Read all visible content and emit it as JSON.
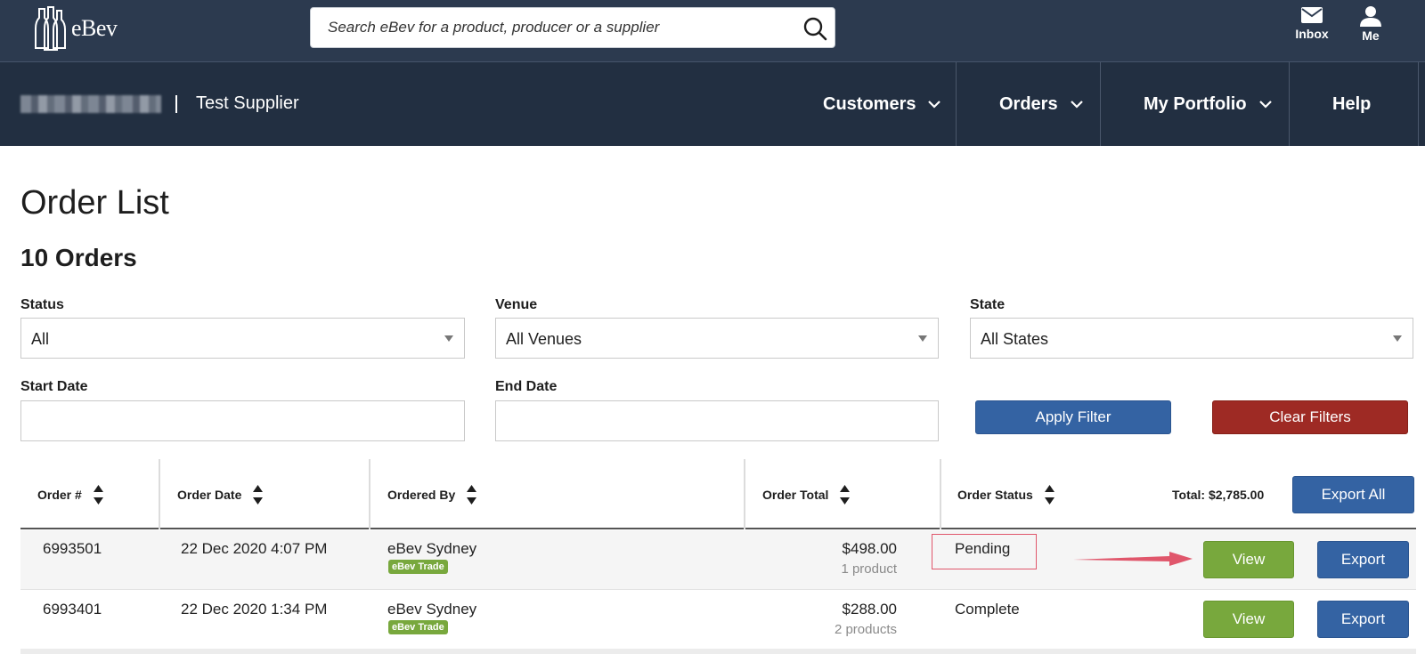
{
  "brand": {
    "name": "eBev"
  },
  "search": {
    "placeholder": "Search eBev for a product, producer or a supplier"
  },
  "top_actions": {
    "inbox_label": "Inbox",
    "me_label": "Me"
  },
  "subnav": {
    "supplier_name": "Test Supplier",
    "items": [
      {
        "label": "Customers"
      },
      {
        "label": "Orders"
      },
      {
        "label": "My Portfolio"
      },
      {
        "label": "Help"
      }
    ]
  },
  "page": {
    "title": "Order List",
    "count_label": "10 Orders"
  },
  "filters": {
    "status": {
      "label": "Status",
      "value": "All"
    },
    "venue": {
      "label": "Venue",
      "value": "All Venues"
    },
    "state": {
      "label": "State",
      "value": "All States"
    },
    "start_date": {
      "label": "Start Date",
      "value": ""
    },
    "end_date": {
      "label": "End Date",
      "value": ""
    },
    "apply_label": "Apply Filter",
    "clear_label": "Clear Filters"
  },
  "table": {
    "headers": {
      "order_no": "Order #",
      "order_date": "Order Date",
      "ordered_by": "Ordered By",
      "order_total": "Order Total",
      "order_status": "Order Status"
    },
    "total_label": "Total: $2,785.00",
    "export_all_label": "Export All",
    "rows": [
      {
        "order_no": "6993501",
        "date": "22 Dec 2020 4:07 PM",
        "ordered_by": "eBev Sydney",
        "badge": "eBev Trade",
        "total": "$498.00",
        "products": "1 product",
        "status": "Pending",
        "view_label": "View",
        "export_label": "Export"
      },
      {
        "order_no": "6993401",
        "date": "22 Dec 2020 1:34 PM",
        "ordered_by": "eBev Sydney",
        "badge": "eBev Trade",
        "total": "$288.00",
        "products": "2 products",
        "status": "Complete",
        "view_label": "View",
        "export_label": "Export"
      }
    ]
  },
  "colors": {
    "topbar": "#2c3a4f",
    "subnav": "#222f41",
    "primary": "#3463a3",
    "danger": "#9e2a24",
    "success": "#78a83d",
    "annotation": "#e0566b"
  }
}
